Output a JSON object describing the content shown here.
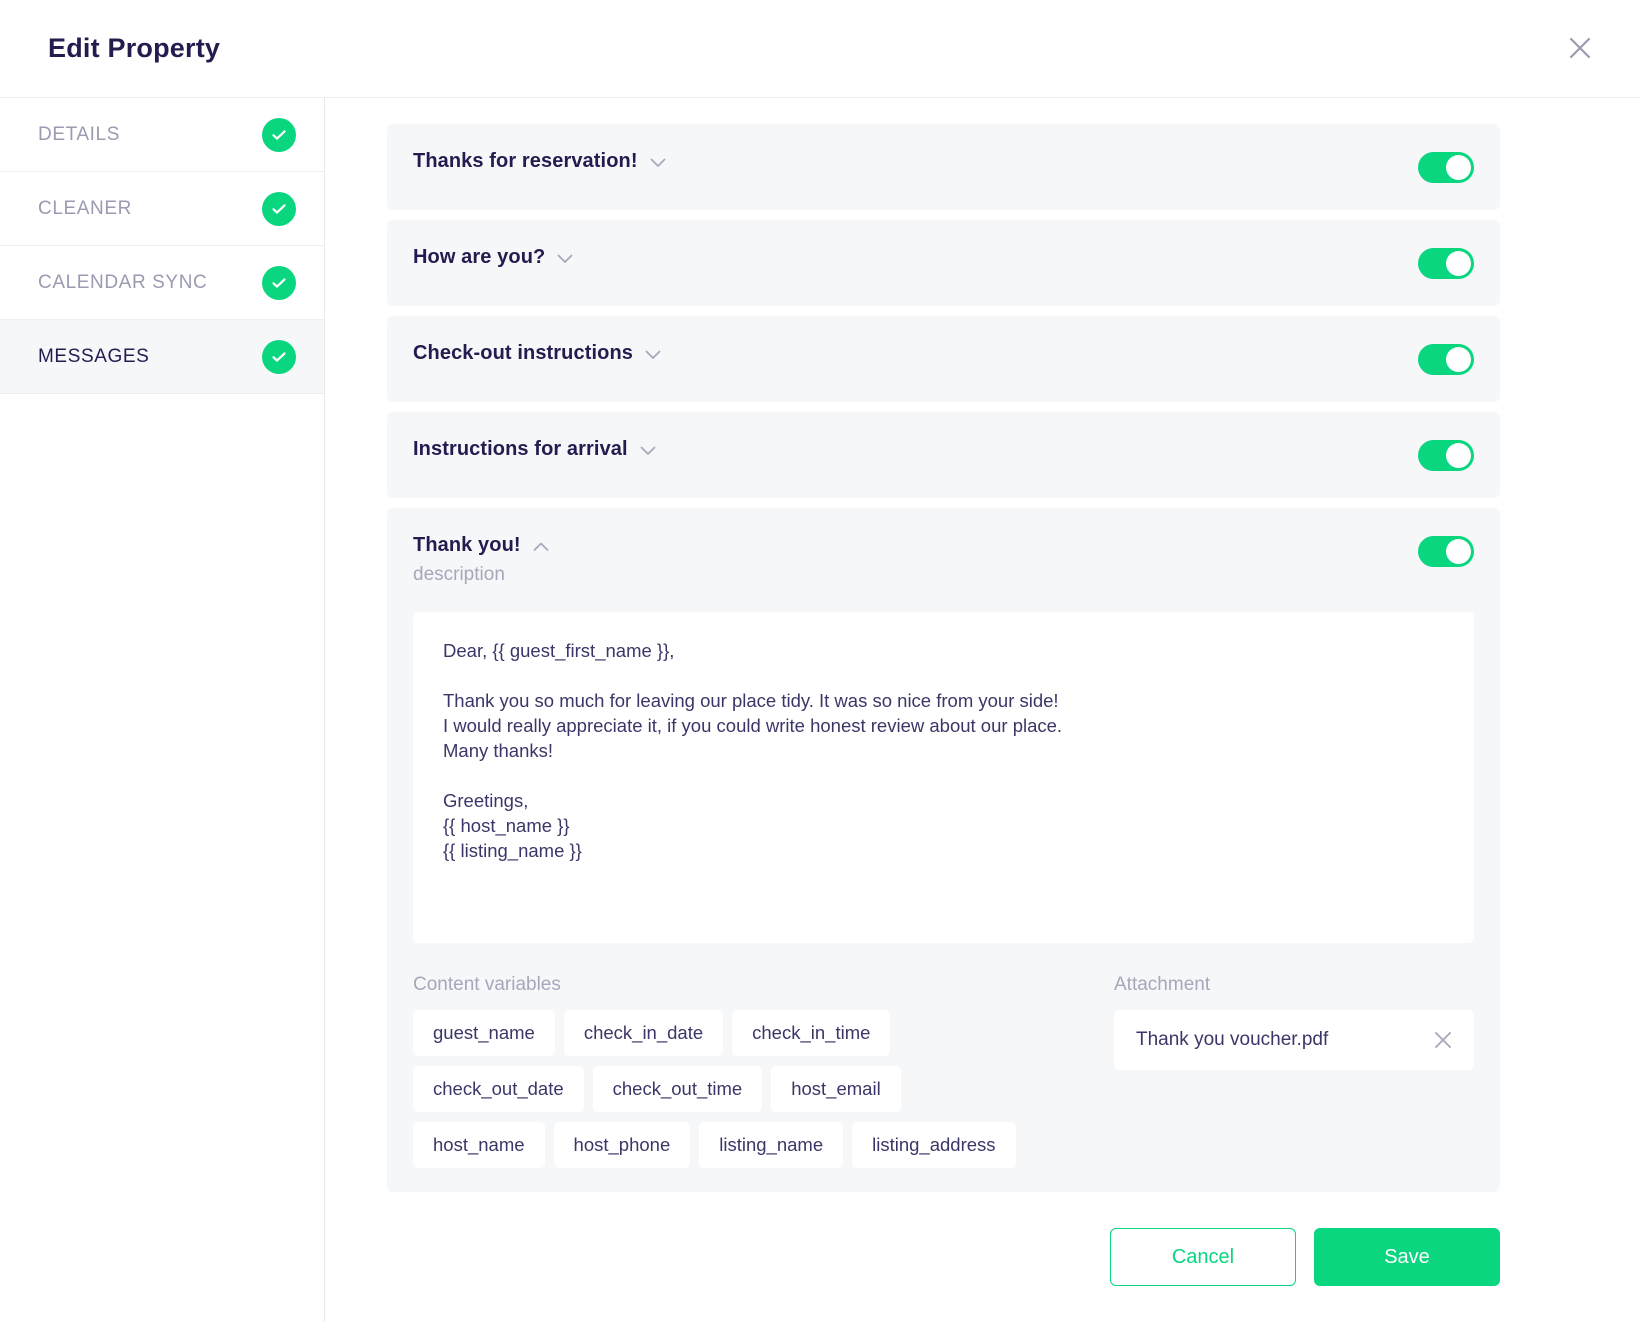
{
  "header": {
    "title": "Edit Property",
    "close_icon": "close-icon"
  },
  "sidebar": {
    "items": [
      {
        "label": "DETAILS",
        "completed": true,
        "active": false
      },
      {
        "label": "CLEANER",
        "completed": true,
        "active": false
      },
      {
        "label": "CALENDAR SYNC",
        "completed": true,
        "active": false
      },
      {
        "label": "MESSAGES",
        "completed": true,
        "active": true
      }
    ]
  },
  "messages": [
    {
      "title": "Thanks for reservation!",
      "expanded": false,
      "enabled": true,
      "chevron": "chevron-down-icon"
    },
    {
      "title": "How are you?",
      "expanded": false,
      "enabled": true,
      "chevron": "chevron-down-icon"
    },
    {
      "title": "Check-out instructions",
      "expanded": false,
      "enabled": true,
      "chevron": "chevron-down-icon"
    },
    {
      "title": "Instructions for arrival",
      "expanded": false,
      "enabled": true,
      "chevron": "chevron-down-icon"
    },
    {
      "title": "Thank you!",
      "expanded": true,
      "enabled": true,
      "chevron": "chevron-up-icon",
      "description": "description"
    }
  ],
  "expanded_message": {
    "title": "Thank you!",
    "description": "description",
    "body": "Dear, {{ guest_first_name }},\n\nThank you so much for leaving our place tidy. It was so nice from your side!\nI would really appreciate it, if you could write honest review about our place.\nMany thanks!\n\nGreetings,\n{{ host_name }}\n{{ listing_name }}",
    "content_variables_label": "Content variables",
    "content_variables": [
      "guest_name",
      "check_in_date",
      "check_in_time",
      "check_out_date",
      "check_out_time",
      "host_email",
      "host_name",
      "host_phone",
      "listing_name",
      "listing_address"
    ],
    "attachment_label": "Attachment",
    "attachment_name": "Thank you voucher.pdf",
    "attachment_remove_icon": "close-icon"
  },
  "footer": {
    "cancel_label": "Cancel",
    "save_label": "Save"
  },
  "colors": {
    "accent_green": "#0ad67f",
    "text_dark": "#241c4f",
    "text_muted": "#a6a7ba",
    "panel_bg": "#f6f7f9"
  }
}
